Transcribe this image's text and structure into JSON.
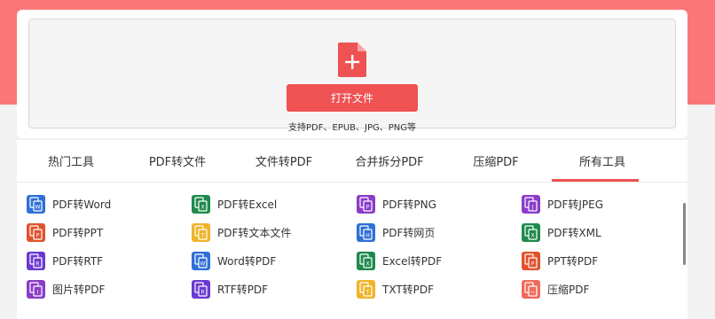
{
  "open": {
    "button_label": "打开文件",
    "support_text": "支持PDF、EPUB、JPG、PNG等",
    "accent_color": "#ee5252"
  },
  "tabs": [
    {
      "label": "热门工具",
      "active": false
    },
    {
      "label": "PDF转文件",
      "active": false
    },
    {
      "label": "文件转PDF",
      "active": false
    },
    {
      "label": "合并拆分PDF",
      "active": false
    },
    {
      "label": "压缩PDF",
      "active": false
    },
    {
      "label": "所有工具",
      "active": true
    }
  ],
  "tools": [
    [
      {
        "label": "PDF转Word",
        "icon": "word-doc-icon",
        "color": "#2f6fd8"
      },
      {
        "label": "PDF转Excel",
        "icon": "excel-doc-icon",
        "color": "#1e8a4c"
      },
      {
        "label": "PDF转PNG",
        "icon": "png-image-icon",
        "color": "#8a3dc9"
      },
      {
        "label": "PDF转JPEG",
        "icon": "jpeg-image-icon",
        "color": "#8a3dc9"
      }
    ],
    [
      {
        "label": "PDF转PPT",
        "icon": "ppt-doc-icon",
        "color": "#e0532c"
      },
      {
        "label": "PDF转文本文件",
        "icon": "text-doc-icon",
        "color": "#f0b429"
      },
      {
        "label": "PDF转网页",
        "icon": "webpage-icon",
        "color": "#2f6fd8"
      },
      {
        "label": "PDF转XML",
        "icon": "xml-doc-icon",
        "color": "#1e8a4c"
      }
    ],
    [
      {
        "label": "PDF转RTF",
        "icon": "rtf-doc-icon",
        "color": "#6a3ad0"
      },
      {
        "label": "Word转PDF",
        "icon": "word-to-pdf-icon",
        "color": "#2f6fd8"
      },
      {
        "label": "Excel转PDF",
        "icon": "excel-to-pdf-icon",
        "color": "#1e8a4c"
      },
      {
        "label": "PPT转PDF",
        "icon": "ppt-to-pdf-icon",
        "color": "#e0532c"
      }
    ],
    [
      {
        "label": "图片转PDF",
        "icon": "image-to-pdf-icon",
        "color": "#8a3dc9"
      },
      {
        "label": "RTF转PDF",
        "icon": "rtf-to-pdf-icon",
        "color": "#6a3ad0"
      },
      {
        "label": "TXT转PDF",
        "icon": "txt-to-pdf-icon",
        "color": "#f0b429"
      },
      {
        "label": "压缩PDF",
        "icon": "compress-pdf-icon",
        "color": "#f06a5a"
      }
    ]
  ]
}
